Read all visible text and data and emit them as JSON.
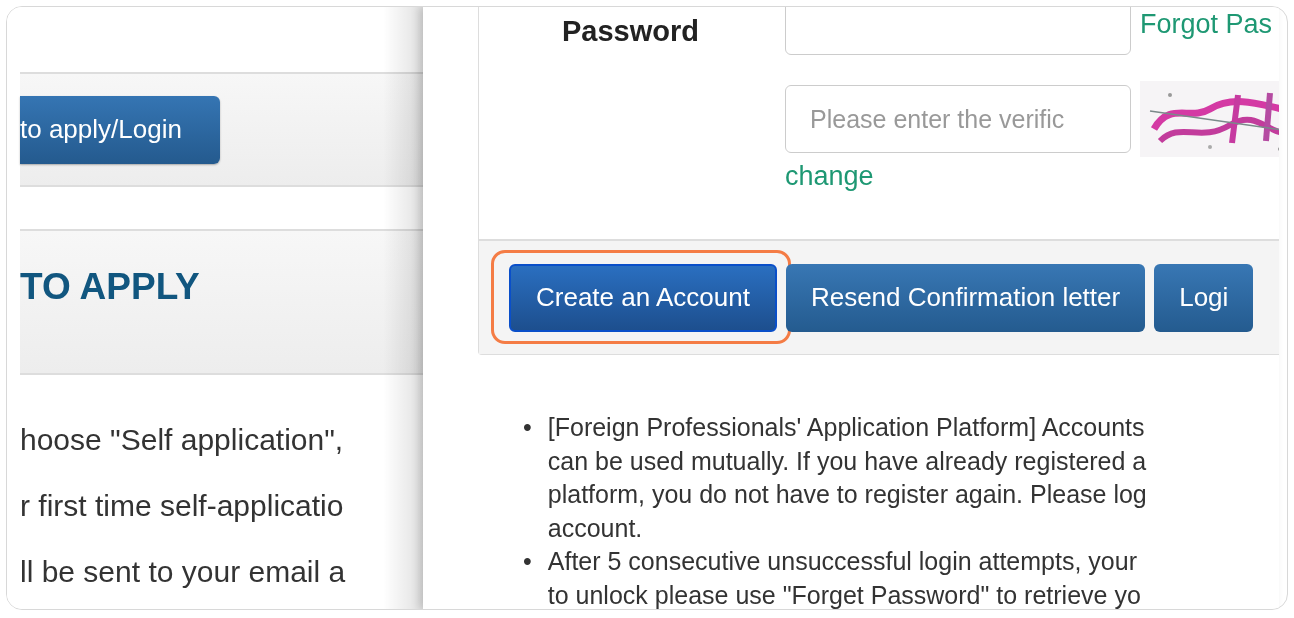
{
  "back_page": {
    "apply_button": "to apply/Login",
    "section_heading": "TO APPLY",
    "paragraphs": [
      "hoose \"Self application\",",
      "r first time self-applicatio",
      "ll be sent to your email a"
    ]
  },
  "login_panel": {
    "password_label": "Password",
    "forgot_link": "Forgot Pas",
    "captcha_field": {
      "placeholder": "Please enter the verific"
    },
    "change_link": "change",
    "buttons": [
      {
        "label": "Create an Account",
        "highlighted": true
      },
      {
        "label": "Resend Confirmation letter",
        "highlighted": false
      },
      {
        "label": "Logi",
        "highlighted": false
      }
    ],
    "notes": [
      {
        "marker": "•",
        "lines": [
          "[Foreign Professionals' Application Platform] Accounts",
          "can be used mutually. If you have already registered a",
          "platform, you do not have to register again. Please log",
          "account."
        ]
      },
      {
        "marker": "•",
        "lines": [
          "After 5 consecutive unsuccessful login attempts, your",
          "to unlock please use \"Forget Password\" to retrieve yo"
        ]
      }
    ]
  }
}
